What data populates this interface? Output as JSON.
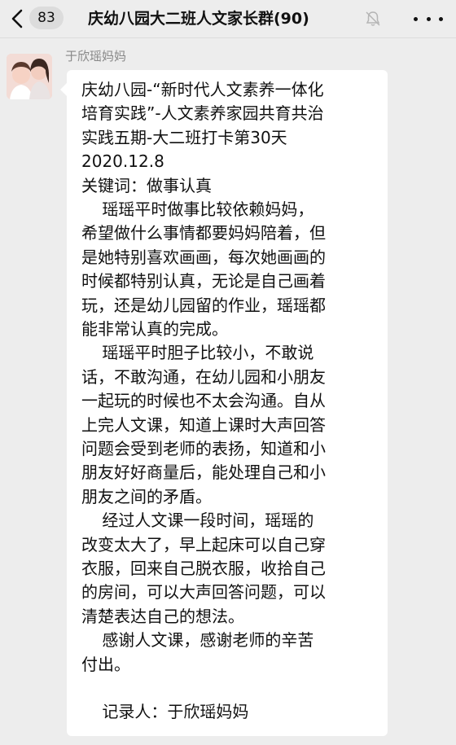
{
  "header": {
    "unread_count": "83",
    "title": "庆幼八园大二班人文家长群(90)"
  },
  "message": {
    "sender": "于欣瑶妈妈",
    "lines": [
      "庆幼八园-“新时代人文素养一体化",
      "培育实践”-人文素养家园共育共治",
      "实践五期-大二班打卡第30天",
      "2020.12.8",
      "关键词：做事认真",
      "    瑶瑶平时做事比较依赖妈妈，",
      "希望做什么事情都要妈妈陪着，但",
      "是她特别喜欢画画，每次她画画的",
      "时候都特别认真，无论是自己画着",
      "玩，还是幼儿园留的作业，瑶瑶都",
      "能非常认真的完成。",
      "    瑶瑶平时胆子比较小，不敢说",
      "话，不敢沟通，在幼儿园和小朋友",
      "一起玩的时候也不太会沟通。自从",
      "上完人文课，知道上课时大声回答",
      "问题会受到老师的表扬，知道和小",
      "朋友好好商量后，能处理自己和小",
      "朋友之间的矛盾。",
      "    经过人文课一段时间，瑶瑶的",
      "改变太大了，早上起床可以自己穿",
      "衣服，回来自己脱衣服，收拾自己",
      "的房间，可以大声回答问题，可以",
      "清楚表达自己的想法。",
      "    感谢人文课，感谢老师的辛苦",
      "付出。",
      "",
      "    记录人：于欣瑶妈妈"
    ]
  }
}
